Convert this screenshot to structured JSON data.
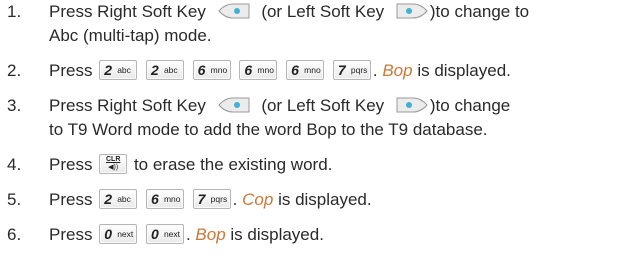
{
  "steps": [
    {
      "num": "1.",
      "line1_a": "Press Right Soft Key",
      "line1_b": "(or Left Soft Key",
      "line1_c": ")to change to",
      "line2": "Abc (multi-tap) mode."
    },
    {
      "num": "2.",
      "pre": "Press",
      "keys": [
        {
          "digit": "2",
          "letters": "abc"
        },
        {
          "digit": "2",
          "letters": "abc"
        },
        {
          "digit": "6",
          "letters": "mno"
        },
        {
          "digit": "6",
          "letters": "mno"
        },
        {
          "digit": "6",
          "letters": "mno"
        },
        {
          "digit": "7",
          "letters": "pqrs"
        }
      ],
      "sep": ".",
      "word": "Bop",
      "post": "is displayed."
    },
    {
      "num": "3.",
      "line1_a": "Press Right Soft Key",
      "line1_b": "(or Left Soft Key",
      "line1_c": ")to change",
      "line2": "to T9 Word mode to add the word Bop to the T9 database."
    },
    {
      "num": "4.",
      "pre": "Press",
      "clr_top": "CLR",
      "clr_sym": "◀))",
      "post": "to erase the existing word."
    },
    {
      "num": "5.",
      "pre": "Press",
      "keys": [
        {
          "digit": "2",
          "letters": "abc"
        },
        {
          "digit": "6",
          "letters": "mno"
        },
        {
          "digit": "7",
          "letters": "pqrs"
        }
      ],
      "sep": ".",
      "word": "Cop",
      "post": "is displayed."
    },
    {
      "num": "6.",
      "pre": "Press",
      "keys": [
        {
          "digit": "0",
          "letters": "next"
        },
        {
          "digit": "0",
          "letters": "next"
        }
      ],
      "sep": ".",
      "word": "Bop",
      "post": "is displayed."
    }
  ],
  "icons": {
    "right_soft": "right-soft-key-icon",
    "left_soft": "left-soft-key-icon",
    "clr": "clr-key-icon"
  }
}
